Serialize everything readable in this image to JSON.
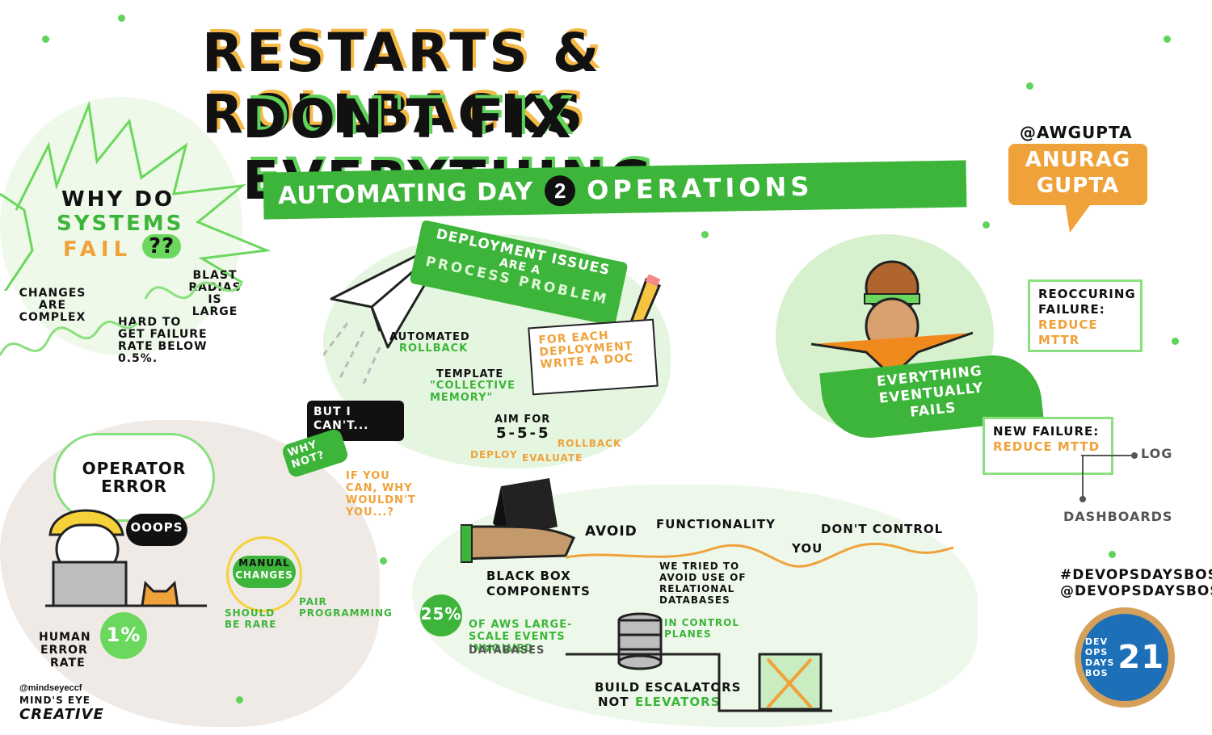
{
  "title": {
    "line1": "RESTARTS & ROLLBACKS",
    "line2": "DON'T FIX EVERYTHING",
    "banner": "AUTOMATING DAY",
    "banner_number": "2",
    "banner_end": "OPERATIONS"
  },
  "speaker": {
    "handle": "@AWGUPTA",
    "name_line1": "ANURAG",
    "name_line2": "GUPTA"
  },
  "why_fail": {
    "q1": "WHY DO",
    "q2": "SYSTEMS",
    "q3": "FAIL",
    "q4": "??",
    "changes": "CHANGES ARE COMPLEX",
    "blast": "BLAST RADIAS IS LARGE",
    "hard": "HARD TO GET FAILURE RATE BELOW 0.5%."
  },
  "deployment": {
    "banner_line1": "DEPLOYMENT ISSUES",
    "banner_line2": "ARE A",
    "banner_line3": "PROCESS PROBLEM",
    "automated": "AUTOMATED",
    "rollback": "ROLLBACK",
    "template": "TEMPLATE",
    "collective": "\"COLLECTIVE MEMORY\"",
    "doc": "FOR EACH DEPLOYMENT WRITE A DOC",
    "aim": "AIM FOR",
    "sss": "5-5-5",
    "deploy": "DEPLOY",
    "evaluate": "EVALUATE",
    "rollback2": "ROLLBACK",
    "but": "BUT I CAN'T...",
    "why_not": "WHY NOT?",
    "if_you": "IF YOU CAN, WHY WOULDN'T YOU...?"
  },
  "operator": {
    "title_line1": "OPERATOR",
    "title_line2": "ERROR",
    "oops": "OOOPS",
    "human_line1": "HUMAN",
    "human_line2": "ERROR",
    "human_line3": "RATE",
    "rate": "1%",
    "manual_line1": "MANUAL",
    "manual_line2": "CHANGES",
    "rare": "SHOULD BE RARE",
    "pair": "PAIR PROGRAMMING"
  },
  "fails": {
    "everything_line1": "EVERYTHING",
    "everything_line2": "EVENTUALLY",
    "everything_line3": "FAILS",
    "reoccur_title": "REOCCURING FAILURE:",
    "reoccur_value": "REDUCE MTTR",
    "new_title": "NEW FAILURE:",
    "new_value": "REDUCE MTTD",
    "log": "LOG",
    "dashboards": "DASHBOARDS"
  },
  "blackbox": {
    "label": "BLACK BOX COMPONENTS",
    "avoid1": "AVOID",
    "avoid2": "FUNCTIONALITY",
    "avoid3": "YOU",
    "avoid4": "DON'T CONTROL",
    "tried": "WE TRIED TO AVOID USE OF RELATIONAL DATABASES",
    "tried_green": "IN CONTROL PLANES",
    "pct": "25%",
    "aws1": "OF AWS LARGE-SCALE EVENTS INVOLVED",
    "aws2": "DATABASES",
    "build": "BUILD ESCALATORS",
    "not": "NOT",
    "elevators": "ELEVATORS"
  },
  "event": {
    "hashtag": "#DEVOPSDAYSBOS",
    "handle": "@DEVOPSDAYSBOS",
    "logo_line1": "DEV",
    "logo_line2": "OPS",
    "logo_line3": "DAYS",
    "logo_line4": "BOS",
    "logo_year": "21"
  },
  "credit": {
    "handle": "@mindseyeccf",
    "line1": "MIND'S EYE",
    "line2": "CREATIVE"
  },
  "colors": {
    "green": "#3db53a",
    "light_green": "#e5f6e0",
    "orange": "#f0a23a",
    "black": "#111111"
  }
}
